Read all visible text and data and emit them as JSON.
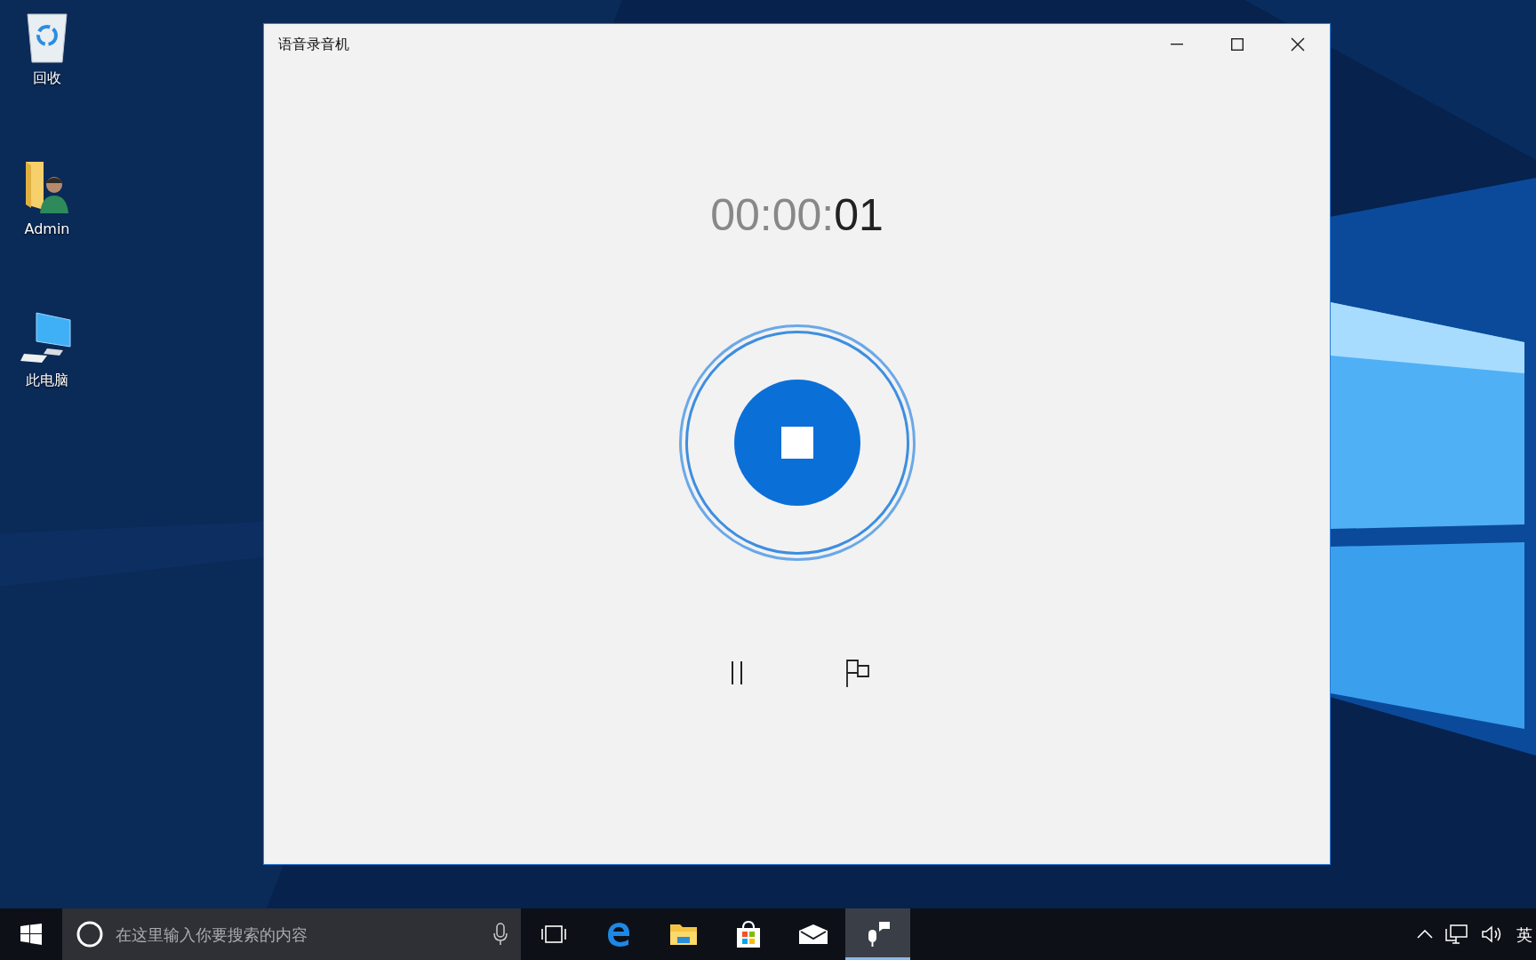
{
  "desktop": {
    "icons": [
      {
        "kind": "recycle-bin",
        "label": "回收"
      },
      {
        "kind": "user-folder",
        "label": "Admin"
      },
      {
        "kind": "computer",
        "label": "此电脑"
      }
    ]
  },
  "window": {
    "title": "语音录音机",
    "timer": {
      "elapsed": "00:00:",
      "seconds": "01"
    },
    "recording": true
  },
  "taskbar": {
    "search": {
      "placeholder": "在这里输入你要搜索的内容"
    },
    "apps": [
      {
        "kind": "task-view",
        "selected": false
      },
      {
        "kind": "edge",
        "selected": false
      },
      {
        "kind": "explorer",
        "selected": false
      },
      {
        "kind": "store",
        "selected": false
      },
      {
        "kind": "mail",
        "selected": false
      },
      {
        "kind": "recorder",
        "selected": true
      }
    ],
    "tray": {
      "input_language": "英"
    }
  }
}
